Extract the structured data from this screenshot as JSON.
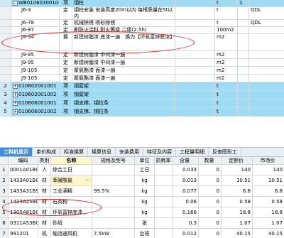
{
  "top_grid": {
    "rows": [
      {
        "idx": "",
        "code": "WB010603001002",
        "type": "项",
        "name": "钢柱",
        "feature": "",
        "unit": "t",
        "qty": "1",
        "expr": "",
        "style": "blue",
        "expand": "−"
      },
      {
        "idx": "",
        "code": "J6-3",
        "type": "定",
        "name": "钢柱安装 安装高度20m以内 每根质量在5t以内",
        "feature": "",
        "unit": "t",
        "qty": "",
        "expr": "QDL",
        "style": "",
        "expand": ""
      },
      {
        "idx": "",
        "code": "J6-78",
        "type": "定",
        "name": "机械除锈 喷砂除锈",
        "feature": "",
        "unit": "t",
        "qty": "",
        "expr": "QDL",
        "style": "",
        "expand": ""
      },
      {
        "idx": "",
        "code": "J6-87",
        "type": "定",
        "name": "刷防火涂料 耐火等级 二级(2.5h)",
        "feature": "",
        "unit": "100m2",
        "qty": "",
        "expr": "",
        "style": "",
        "expand": ""
      },
      {
        "idx": "",
        "code": "J9-94",
        "type": "换",
        "name": "新建树脂漆 底漆一遍　换为【环氧富锌底漆】",
        "feature": "",
        "unit": "m2",
        "qty": "",
        "expr": "",
        "style": "sel",
        "expand": ""
      },
      {
        "idx": "",
        "code": "J9-95",
        "type": "定",
        "name": "新建树脂漆 中间漆一遍",
        "feature": "",
        "unit": "m2",
        "qty": "",
        "expr": "",
        "style": "",
        "expand": ""
      },
      {
        "idx": "",
        "code": "J9-95",
        "type": "定",
        "name": "新建树脂漆 中间漆一遍",
        "feature": "",
        "unit": "m2",
        "qty": "",
        "expr": "",
        "style": "",
        "expand": ""
      },
      {
        "idx": "",
        "code": "J9-105",
        "type": "定",
        "name": "聚氨酯漆 面漆一遍",
        "feature": "",
        "unit": "m2",
        "qty": "",
        "expr": "",
        "style": "",
        "expand": ""
      },
      {
        "idx": "",
        "code": "J9-105",
        "type": "定",
        "name": "聚氨酯漆 面漆一遍",
        "feature": "",
        "unit": "m2",
        "qty": "",
        "expr": "",
        "style": "",
        "expand": ""
      },
      {
        "idx": "2",
        "code": "010602001001",
        "type": "项",
        "name": "钢屋架",
        "feature": "",
        "unit": "t",
        "qty": "",
        "expr": "",
        "style": "blue",
        "expand": "+"
      },
      {
        "idx": "3",
        "code": "010602001002",
        "type": "项",
        "name": "钢屋架",
        "feature": "",
        "unit": "t",
        "qty": "",
        "expr": "",
        "style": "blue",
        "expand": "+"
      },
      {
        "idx": "4",
        "code": "010606001001",
        "type": "项",
        "name": "钢支撑、钢拉条",
        "feature": "",
        "unit": "t",
        "qty": "",
        "expr": "",
        "style": "blue",
        "expand": "+"
      },
      {
        "idx": "5",
        "code": "010606001002",
        "type": "项",
        "name": "钢支撑、钢拉条",
        "feature": "",
        "unit": "t",
        "qty": "",
        "expr": "",
        "style": "blue",
        "expand": "+"
      }
    ]
  },
  "tabs": [
    "工料机显示",
    "单价构成",
    "标准换算",
    "换算信息",
    "安装费用",
    "特征及内容",
    "工程量明细",
    "反查图形工"
  ],
  "bottom_grid": {
    "headers": {
      "code": "编码",
      "cat": "类别",
      "name": "名称",
      "spec": "规格及型号",
      "unit": "单位",
      "loss": "损耗率",
      "cons": "含量",
      "qty": "数量",
      "price": "定额价",
      "market": "市场价"
    },
    "rows": [
      {
        "idx": "1",
        "code": "0001A01B0",
        "cat": "人",
        "name": "综合工日",
        "spec": "",
        "unit": "工日",
        "loss": "",
        "cons": "0.033",
        "qty": "0",
        "price": "140",
        "market": "140"
      },
      {
        "idx": "2",
        "code": "1433A01B0",
        "cat": "材",
        "name": "苯磺酸氯",
        "spec": "",
        "unit": "kg",
        "loss": "",
        "cons": "0.013",
        "qty": "0",
        "price": "10.51",
        "market": "10.51"
      },
      {
        "idx": "3",
        "code": "1433A31B9",
        "cat": "材",
        "name": "工业酒精",
        "spec": "99.5%",
        "unit": "kg",
        "loss": "",
        "cons": "0.077",
        "qty": "0",
        "price": "6.8",
        "market": "6.8"
      },
      {
        "idx": "4",
        "code": "1423A25B0",
        "cat": "材",
        "name": "石英粉",
        "spec": "",
        "unit": "kg",
        "loss": "",
        "cons": "0.06",
        "qty": "0",
        "price": "0.58",
        "market": "0.58"
      },
      {
        "idx": "5",
        "code": "1305A81B0",
        "cat": "材",
        "name": "环氧富锌底漆",
        "spec": "",
        "unit": "kg",
        "loss": "",
        "cons": "0.166",
        "qty": "0",
        "price": "18.8",
        "market": "18.8"
      },
      {
        "idx": "6",
        "code": "0311A53B0",
        "cat": "材",
        "name": "砂纸",
        "spec": "",
        "unit": "张",
        "loss": "",
        "cons": "0.3",
        "qty": "0",
        "price": "1.07",
        "market": "1.07"
      },
      {
        "idx": "7",
        "code": "991201",
        "cat": "机",
        "name": "轴流通风机",
        "spec": "7.5kW",
        "unit": "台班",
        "loss": "",
        "cons": "0.012",
        "qty": "0",
        "price": "40.15",
        "market": "40.15"
      }
    ]
  }
}
